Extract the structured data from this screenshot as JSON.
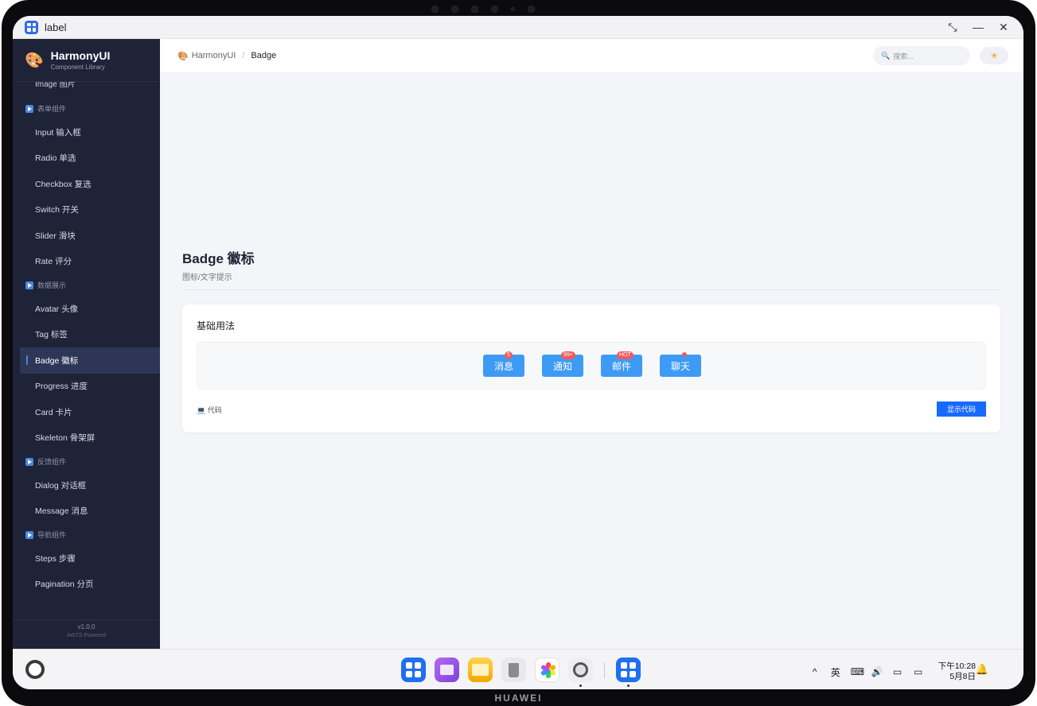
{
  "device": {
    "brand": "HUAWEI"
  },
  "window": {
    "title": "label",
    "controls": {
      "restore": "⤡",
      "minimize": "—",
      "close": "✕"
    }
  },
  "sidebar": {
    "logo_icon": "palette-icon",
    "brand": "HarmonyUI",
    "subtitle": "Component Library",
    "cut_item": "Image 图片",
    "groups": [
      {
        "label": "表单组件",
        "items": [
          "Input 输入框",
          "Radio 单选",
          "Checkbox 复选",
          "Switch 开关",
          "Slider 滑块",
          "Rate 评分"
        ]
      },
      {
        "label": "数据展示",
        "items": [
          "Avatar 头像",
          "Tag 标签",
          "Badge 徽标",
          "Progress 进度",
          "Card 卡片",
          "Skeleton 骨架屏"
        ]
      },
      {
        "label": "反馈组件",
        "items": [
          "Dialog 对话框",
          "Message 消息"
        ]
      },
      {
        "label": "导航组件",
        "items": [
          "Steps 步骤",
          "Pagination 分页"
        ]
      }
    ],
    "active_item": "Badge 徽标",
    "version": "v1.0.0",
    "powered": "ArkTS Powered"
  },
  "header": {
    "breadcrumb_home": "HarmonyUI",
    "breadcrumb_sep": "/",
    "breadcrumb_current": "Badge",
    "search_placeholder": "搜索...",
    "theme_icon": "sun-icon"
  },
  "main": {
    "title": "Badge 徽标",
    "subtitle": "图标/文字提示",
    "card": {
      "title": "基础用法",
      "buttons": [
        {
          "label": "消息",
          "badge": "5"
        },
        {
          "label": "通知",
          "badge": "99+"
        },
        {
          "label": "邮件",
          "badge": "HOT"
        },
        {
          "label": "聊天",
          "badge": ""
        }
      ],
      "code_label": "💻 代码",
      "code_button": "显示代码"
    }
  },
  "taskbar": {
    "time": "下午10:28",
    "date": "5月8日",
    "tray": {
      "chevron": "^",
      "ime": "英",
      "input_mode": "⌨",
      "volume": "🔊",
      "screen": "▭",
      "battery": "▭"
    }
  },
  "colors": {
    "accent": "#1769ff",
    "badge_button": "#3e9bf5",
    "badge": "#f05a5a",
    "sidebar": "#1e2338"
  }
}
